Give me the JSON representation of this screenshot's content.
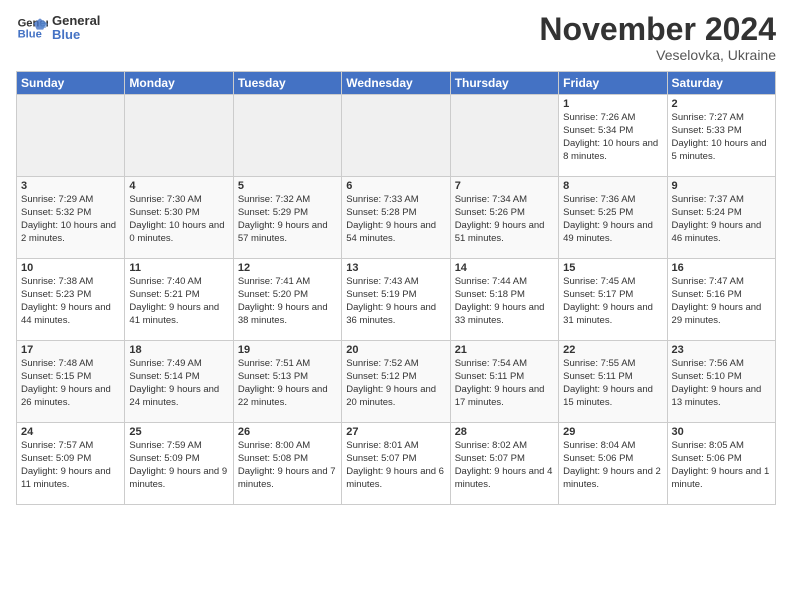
{
  "logo": {
    "line1": "General",
    "line2": "Blue"
  },
  "title": "November 2024",
  "location": "Veselovka, Ukraine",
  "weekdays": [
    "Sunday",
    "Monday",
    "Tuesday",
    "Wednesday",
    "Thursday",
    "Friday",
    "Saturday"
  ],
  "weeks": [
    [
      {
        "day": "",
        "info": ""
      },
      {
        "day": "",
        "info": ""
      },
      {
        "day": "",
        "info": ""
      },
      {
        "day": "",
        "info": ""
      },
      {
        "day": "",
        "info": ""
      },
      {
        "day": "1",
        "info": "Sunrise: 7:26 AM\nSunset: 5:34 PM\nDaylight: 10 hours and 8 minutes."
      },
      {
        "day": "2",
        "info": "Sunrise: 7:27 AM\nSunset: 5:33 PM\nDaylight: 10 hours and 5 minutes."
      }
    ],
    [
      {
        "day": "3",
        "info": "Sunrise: 7:29 AM\nSunset: 5:32 PM\nDaylight: 10 hours and 2 minutes."
      },
      {
        "day": "4",
        "info": "Sunrise: 7:30 AM\nSunset: 5:30 PM\nDaylight: 10 hours and 0 minutes."
      },
      {
        "day": "5",
        "info": "Sunrise: 7:32 AM\nSunset: 5:29 PM\nDaylight: 9 hours and 57 minutes."
      },
      {
        "day": "6",
        "info": "Sunrise: 7:33 AM\nSunset: 5:28 PM\nDaylight: 9 hours and 54 minutes."
      },
      {
        "day": "7",
        "info": "Sunrise: 7:34 AM\nSunset: 5:26 PM\nDaylight: 9 hours and 51 minutes."
      },
      {
        "day": "8",
        "info": "Sunrise: 7:36 AM\nSunset: 5:25 PM\nDaylight: 9 hours and 49 minutes."
      },
      {
        "day": "9",
        "info": "Sunrise: 7:37 AM\nSunset: 5:24 PM\nDaylight: 9 hours and 46 minutes."
      }
    ],
    [
      {
        "day": "10",
        "info": "Sunrise: 7:38 AM\nSunset: 5:23 PM\nDaylight: 9 hours and 44 minutes."
      },
      {
        "day": "11",
        "info": "Sunrise: 7:40 AM\nSunset: 5:21 PM\nDaylight: 9 hours and 41 minutes."
      },
      {
        "day": "12",
        "info": "Sunrise: 7:41 AM\nSunset: 5:20 PM\nDaylight: 9 hours and 38 minutes."
      },
      {
        "day": "13",
        "info": "Sunrise: 7:43 AM\nSunset: 5:19 PM\nDaylight: 9 hours and 36 minutes."
      },
      {
        "day": "14",
        "info": "Sunrise: 7:44 AM\nSunset: 5:18 PM\nDaylight: 9 hours and 33 minutes."
      },
      {
        "day": "15",
        "info": "Sunrise: 7:45 AM\nSunset: 5:17 PM\nDaylight: 9 hours and 31 minutes."
      },
      {
        "day": "16",
        "info": "Sunrise: 7:47 AM\nSunset: 5:16 PM\nDaylight: 9 hours and 29 minutes."
      }
    ],
    [
      {
        "day": "17",
        "info": "Sunrise: 7:48 AM\nSunset: 5:15 PM\nDaylight: 9 hours and 26 minutes."
      },
      {
        "day": "18",
        "info": "Sunrise: 7:49 AM\nSunset: 5:14 PM\nDaylight: 9 hours and 24 minutes."
      },
      {
        "day": "19",
        "info": "Sunrise: 7:51 AM\nSunset: 5:13 PM\nDaylight: 9 hours and 22 minutes."
      },
      {
        "day": "20",
        "info": "Sunrise: 7:52 AM\nSunset: 5:12 PM\nDaylight: 9 hours and 20 minutes."
      },
      {
        "day": "21",
        "info": "Sunrise: 7:54 AM\nSunset: 5:11 PM\nDaylight: 9 hours and 17 minutes."
      },
      {
        "day": "22",
        "info": "Sunrise: 7:55 AM\nSunset: 5:11 PM\nDaylight: 9 hours and 15 minutes."
      },
      {
        "day": "23",
        "info": "Sunrise: 7:56 AM\nSunset: 5:10 PM\nDaylight: 9 hours and 13 minutes."
      }
    ],
    [
      {
        "day": "24",
        "info": "Sunrise: 7:57 AM\nSunset: 5:09 PM\nDaylight: 9 hours and 11 minutes."
      },
      {
        "day": "25",
        "info": "Sunrise: 7:59 AM\nSunset: 5:09 PM\nDaylight: 9 hours and 9 minutes."
      },
      {
        "day": "26",
        "info": "Sunrise: 8:00 AM\nSunset: 5:08 PM\nDaylight: 9 hours and 7 minutes."
      },
      {
        "day": "27",
        "info": "Sunrise: 8:01 AM\nSunset: 5:07 PM\nDaylight: 9 hours and 6 minutes."
      },
      {
        "day": "28",
        "info": "Sunrise: 8:02 AM\nSunset: 5:07 PM\nDaylight: 9 hours and 4 minutes."
      },
      {
        "day": "29",
        "info": "Sunrise: 8:04 AM\nSunset: 5:06 PM\nDaylight: 9 hours and 2 minutes."
      },
      {
        "day": "30",
        "info": "Sunrise: 8:05 AM\nSunset: 5:06 PM\nDaylight: 9 hours and 1 minute."
      }
    ]
  ]
}
